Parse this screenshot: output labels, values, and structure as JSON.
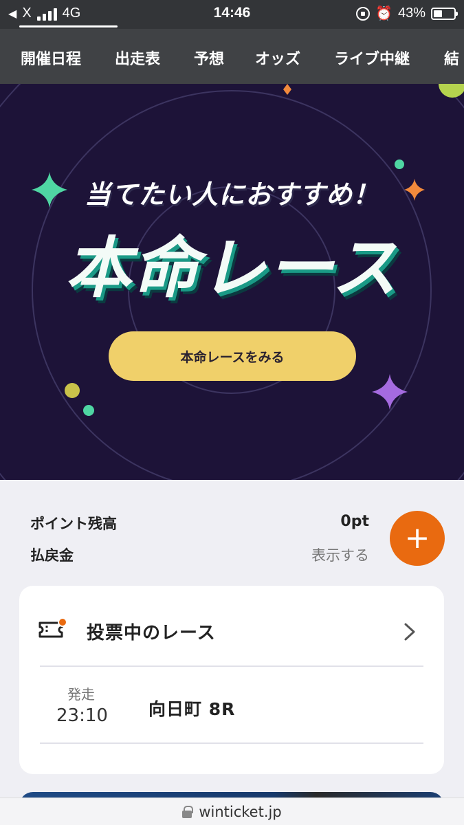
{
  "status_bar": {
    "back_label": "X",
    "network": "4G",
    "time": "14:46",
    "battery": "43%"
  },
  "nav": {
    "tabs": [
      "開催日程",
      "出走表",
      "予想",
      "オッズ",
      "ライブ中継",
      "結"
    ]
  },
  "banner": {
    "subtitle": "当てたい人におすすめ！",
    "title": "本命レース",
    "cta_label": "本命レースをみる",
    "background_color": "#1d1338",
    "cta_color": "#f0d06a"
  },
  "points": {
    "balance_label": "ポイント残高",
    "balance_value": "0pt",
    "payout_label": "払戻金",
    "payout_action": "表示する",
    "add_icon": "plus-icon",
    "accent_color": "#e96a10"
  },
  "betting_card": {
    "icon": "ticket-icon",
    "title": "投票中のレース",
    "race": {
      "start_label": "発走",
      "start_time": "23:10",
      "venue": "向日町 8R"
    }
  },
  "browser": {
    "url": "winticket.jp"
  }
}
